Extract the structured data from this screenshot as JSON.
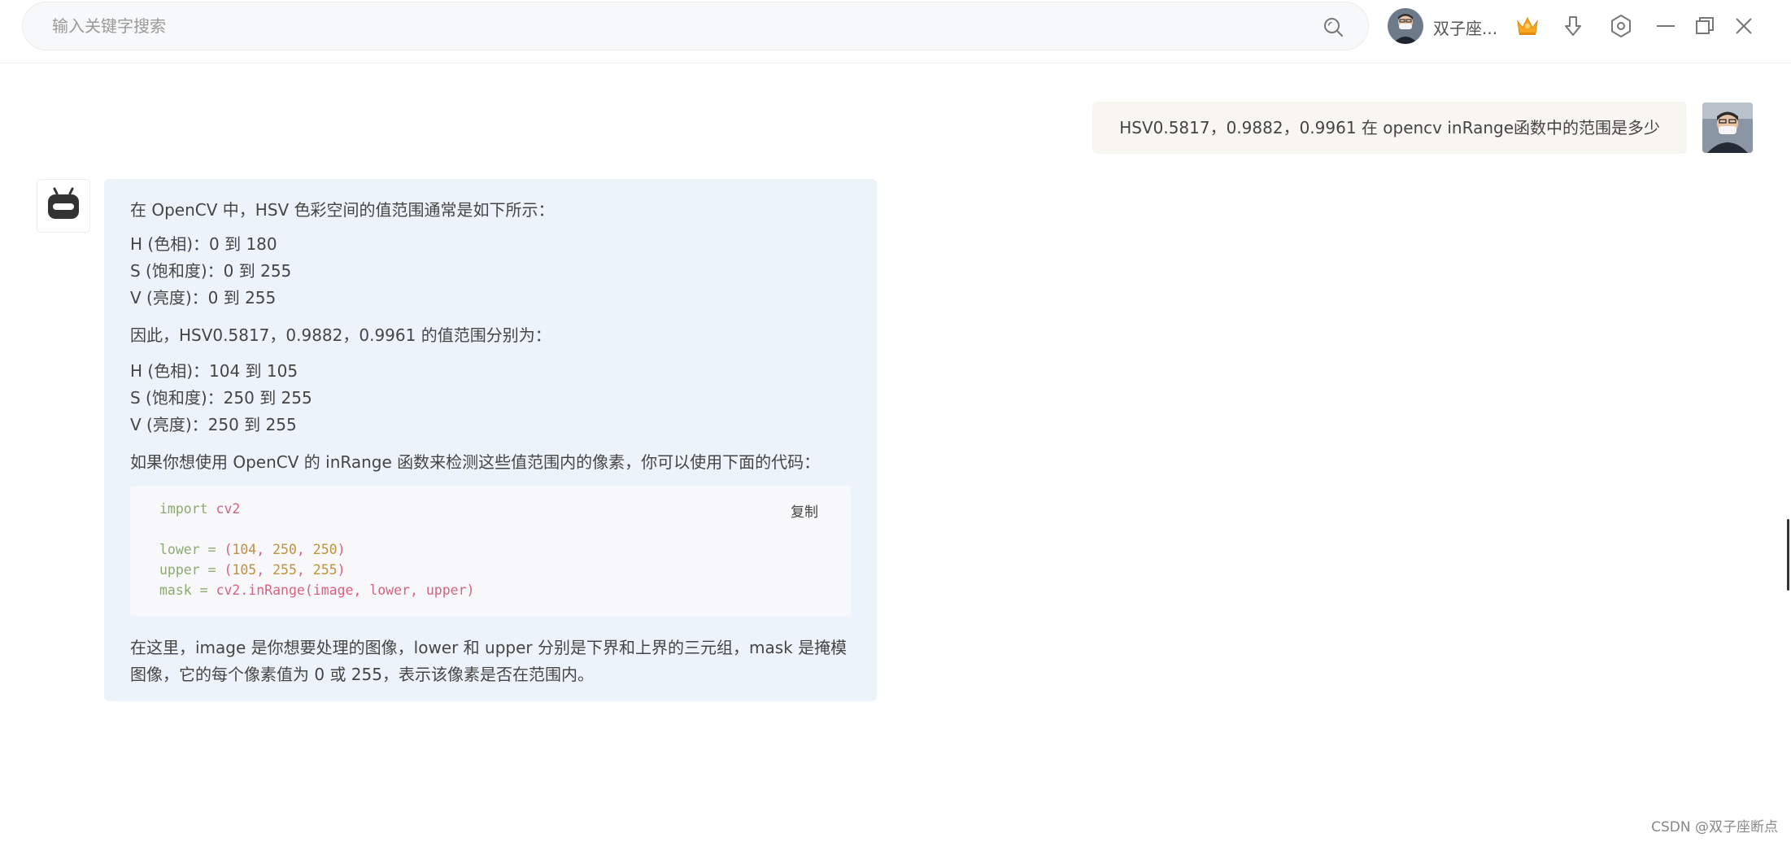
{
  "search": {
    "placeholder": "输入关键字搜索",
    "value": ""
  },
  "header": {
    "user_name": "双子座...",
    "icons": [
      "search-icon",
      "crown-icon",
      "download-icon",
      "settings-icon",
      "minimize-icon",
      "restore-icon",
      "close-icon"
    ],
    "accent_crown": "#f5a623"
  },
  "chat": {
    "user_message": "HSV0.5817，0.9882，0.9961 在 opencv inRange函数中的范围是多少",
    "bot": {
      "intro": "在 OpenCV 中，HSV 色彩空间的值范围通常是如下所示：",
      "ranges": [
        "H (色相)：0 到 180",
        "S (饱和度)：0 到 255",
        "V (亮度)：0 到 255"
      ],
      "therefore": "因此，HSV0.5817，0.9882，0.9961 的值范围分别为：",
      "values": [
        "H (色相)：104 到 105",
        "S (饱和度)：250 到 255",
        "V (亮度)：250 到 255"
      ],
      "if_you": "如果你想使用 OpenCV 的 inRange 函数来检测这些值范围内的像素，你可以使用下面的代码：",
      "code": {
        "copy_label": "复制",
        "line1_kw": "import",
        "line1_id": "cv2",
        "line3_var": "lower",
        "line3_nums": [
          "104",
          "250",
          "250"
        ],
        "line4_var": "upper",
        "line4_nums": [
          "105",
          "255",
          "255"
        ],
        "line5_var": "mask",
        "line5_call": "cv2.inRange(image, lower, upper)"
      },
      "explanation": "在这里，image 是你想要处理的图像，lower 和 upper 分别是下界和上界的三元组，mask 是掩模图像，它的每个像素值为 0 或 255，表示该像素是否在范围内。"
    },
    "bubble_colors": {
      "user": "#f8f6f1",
      "bot": "#edf3fa"
    }
  },
  "watermark": "CSDN @双子座断点"
}
